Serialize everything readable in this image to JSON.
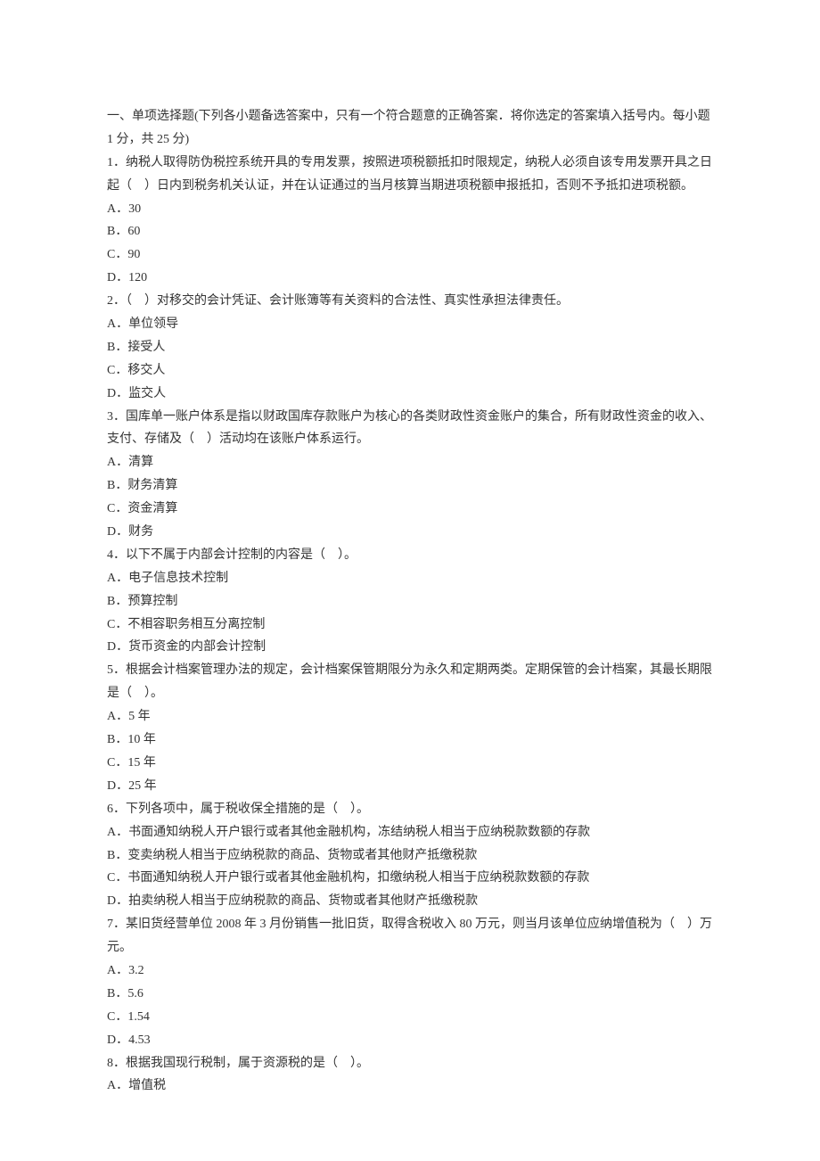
{
  "instructions": "一、单项选择题(下列各小题备选答案中，只有一个符合题意的正确答案．将你选定的答案填入括号内。每小题 1 分，共 25 分)",
  "questions": [
    {
      "stem": "1．纳税人取得防伪税控系统开具的专用发票，按照进项税额抵扣时限规定，纳税人必须自该专用发票开具之日起（　）日内到税务机关认证，并在认证通过的当月核算当期进项税额申报抵扣，否则不予抵扣进项税额。",
      "options": [
        "A．30",
        "B．60",
        "C．90",
        "D．120"
      ]
    },
    {
      "stem": "2．（　）对移交的会计凭证、会计账簿等有关资料的合法性、真实性承担法律责任。",
      "options": [
        "A．单位领导",
        "B．接受人",
        "C．移交人",
        "D．监交人"
      ]
    },
    {
      "stem": "3．国库单一账户体系是指以财政国库存款账户为核心的各类财政性资金账户的集合，所有财政性资金的收入、支付、存储及（　）活动均在该账户体系运行。",
      "options": [
        "A．清算",
        "B．财务清算",
        "C．资金清算",
        "D．财务"
      ]
    },
    {
      "stem": "4．以下不属于内部会计控制的内容是（　）。",
      "options": [
        "A．电子信息技术控制",
        "B．预算控制",
        "C．不相容职务相互分离控制",
        "D．货币资金的内部会计控制"
      ]
    },
    {
      "stem": "5．根据会计档案管理办法的规定，会计档案保管期限分为永久和定期两类。定期保管的会计档案，其最长期限是（　）。",
      "options": [
        "A．5 年",
        "B．10 年",
        "C．15 年",
        "D．25 年"
      ]
    },
    {
      "stem": "6．下列各项中，属于税收保全措施的是（　）。",
      "options": [
        "A．书面通知纳税人开户银行或者其他金融机构，冻结纳税人相当于应纳税款数额的存款",
        "B．变卖纳税人相当于应纳税款的商品、货物或者其他财产抵缴税款",
        "C．书面通知纳税人开户银行或者其他金融机构，扣缴纳税人相当于应纳税款数额的存款",
        "D．拍卖纳税人相当于应纳税款的商品、货物或者其他财产抵缴税款"
      ]
    },
    {
      "stem": "7．某旧货经营单位 2008 年 3 月份销售一批旧货，取得含税收入 80 万元，则当月该单位应纳增值税为（　）万元。",
      "options": [
        "A．3.2",
        "B．5.6",
        "C．1.54",
        "D．4.53"
      ]
    },
    {
      "stem": "8．根据我国现行税制，属于资源税的是（　）。",
      "options": [
        "A．增值税"
      ]
    }
  ]
}
